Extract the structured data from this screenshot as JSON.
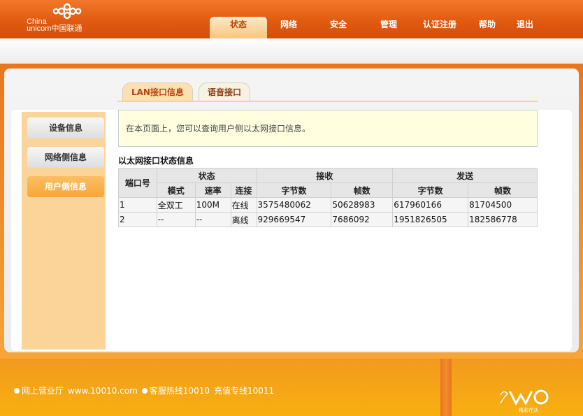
{
  "brand": {
    "logo_line1": "China",
    "logo_line2": "unicom中国联通"
  },
  "nav": [
    {
      "label": "状态",
      "active": true
    },
    {
      "label": "网络",
      "active": false
    },
    {
      "label": "安全",
      "active": false
    },
    {
      "label": "管理",
      "active": false
    },
    {
      "label": "认证注册",
      "active": false
    },
    {
      "label": "帮助",
      "active": false
    },
    {
      "label": "退出",
      "active": false
    }
  ],
  "tabs": [
    {
      "label": "LAN接口信息",
      "active": true
    },
    {
      "label": "语音接口",
      "active": false
    }
  ],
  "sidebar": [
    {
      "label": "设备信息",
      "active": false
    },
    {
      "label": "网络侧信息",
      "active": false
    },
    {
      "label": "用户侧信息",
      "active": true
    }
  ],
  "notice": "在本页面上，您可以查询用户侧以太网接口信息。",
  "section_title": "以太网接口状态信息",
  "table": {
    "headers": {
      "port": "端口号",
      "status": "状态",
      "receive": "接收",
      "send": "发送",
      "mode": "模式",
      "rate": "速率",
      "link": "连接",
      "rx_bytes": "字节数",
      "rx_frames": "帧数",
      "tx_bytes": "字节数",
      "tx_frames": "帧数"
    },
    "rows": [
      {
        "port": "1",
        "mode": "全双工",
        "rate": "100M",
        "link": "在线",
        "rx_bytes": "3575480062",
        "rx_frames": "50628983",
        "tx_bytes": "617960166",
        "tx_frames": "81704500"
      },
      {
        "port": "2",
        "mode": "--",
        "rate": "--",
        "link": "离线",
        "rx_bytes": "929669547",
        "rx_frames": "7686092",
        "tx_bytes": "1951826505",
        "tx_frames": "182586778"
      }
    ]
  },
  "footer": {
    "link1": "网上营业厅",
    "link1_url": "www.10010.com",
    "link2": "客服热线10010",
    "link3": "充值专线10011",
    "slogan": "精彩在沃"
  },
  "colors": {
    "brand_orange": "#e05a10",
    "active_tab": "#fbe0b6",
    "sidebar_bg": "#fad499",
    "notice_bg": "#ffffe0"
  }
}
